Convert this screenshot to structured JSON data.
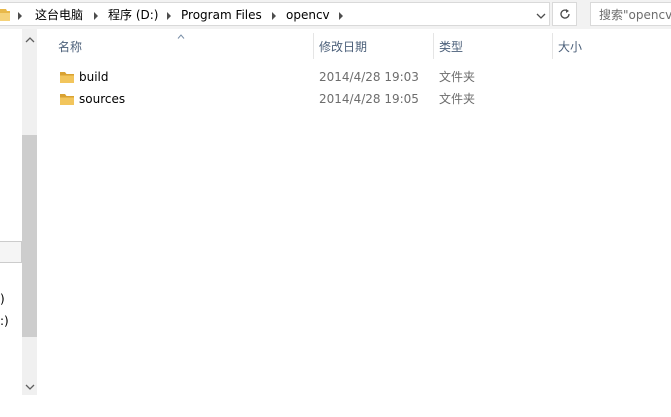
{
  "address_bar": {
    "breadcrumbs": [
      "这台电脑",
      "程序 (D:)",
      "Program Files",
      "opencv"
    ]
  },
  "search": {
    "placeholder": "搜索\"opencv"
  },
  "nav_pane": {
    "partial_items": [
      ")",
      ":)"
    ]
  },
  "file_list": {
    "columns": [
      "名称",
      "修改日期",
      "类型",
      "大小"
    ],
    "rows": [
      {
        "name": "build",
        "modified": "2014/4/28 19:03",
        "type": "文件夹",
        "size": ""
      },
      {
        "name": "sources",
        "modified": "2014/4/28 19:05",
        "type": "文件夹",
        "size": ""
      }
    ]
  },
  "colors": {
    "folder_yellow": "#e8b84a",
    "header_text": "#4c607a",
    "chrome_bg": "#f2f2f2"
  }
}
